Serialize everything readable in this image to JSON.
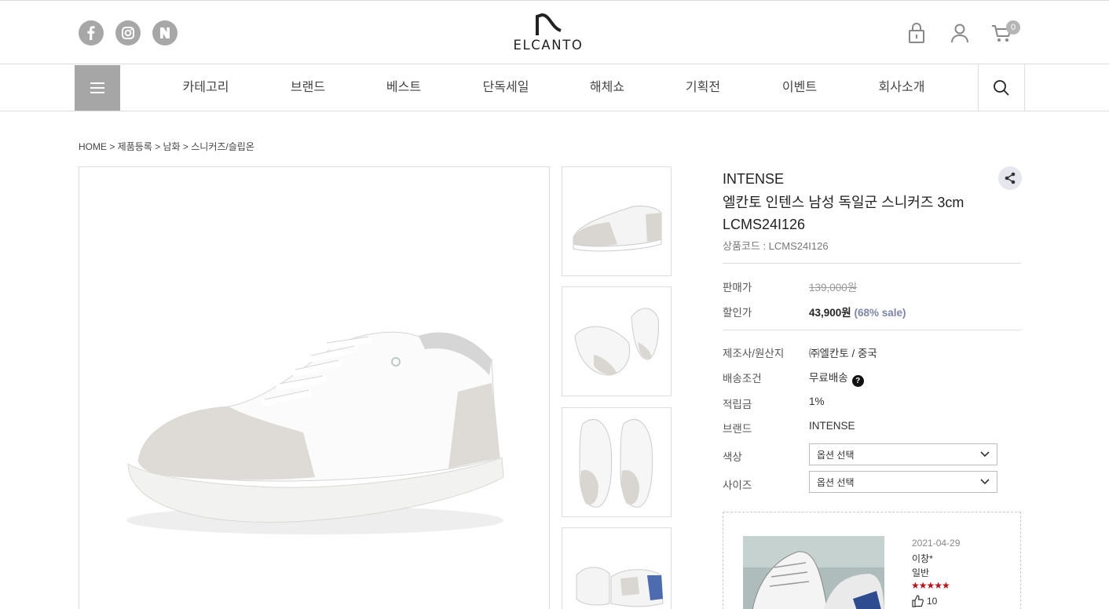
{
  "header": {
    "social": [
      {
        "name": "facebook",
        "glyph": "f"
      },
      {
        "name": "instagram",
        "glyph": ""
      },
      {
        "name": "naver",
        "glyph": "N"
      }
    ],
    "logo_text": "ELCANTO",
    "cart_count": "0"
  },
  "nav": {
    "items": [
      "카테고리",
      "브랜드",
      "베스트",
      "단독세일",
      "해체쇼",
      "기획전",
      "이벤트",
      "회사소개"
    ]
  },
  "breadcrumb": "HOME > 제품등록 > 남화 > 스니커즈/슬립온",
  "product": {
    "brand": "INTENSE",
    "title": "엘칸토 인텐스 남성 독일군 스니커즈 3cm LCMS24I126",
    "code": "상품코드 : LCMS24I126",
    "price_label": "판매가",
    "price": "139,000원",
    "sale_label": "할인가",
    "sale_price": "43,900원",
    "sale_percent": "(68% sale)",
    "maker_label": "제조사/원산지",
    "maker": "㈜엘칸토 / 중국",
    "shipping_label": "배송조건",
    "shipping": "무료배송",
    "points_label": "적립금",
    "points": "1%",
    "brand_label": "브랜드",
    "brand_value": "INTENSE",
    "color_label": "색상",
    "color_select": "옵션 선택",
    "size_label": "사이즈",
    "size_select": "옵션 선택"
  },
  "review": {
    "date": "2021-04-29",
    "name": "이창*",
    "type": "일반",
    "stars": "★★★★★",
    "rating": 5,
    "likes": "10"
  },
  "colors": {
    "icon_gray": "#a7a7a7",
    "sale_accent": "#7d86a8",
    "star_red": "#b5131b"
  }
}
